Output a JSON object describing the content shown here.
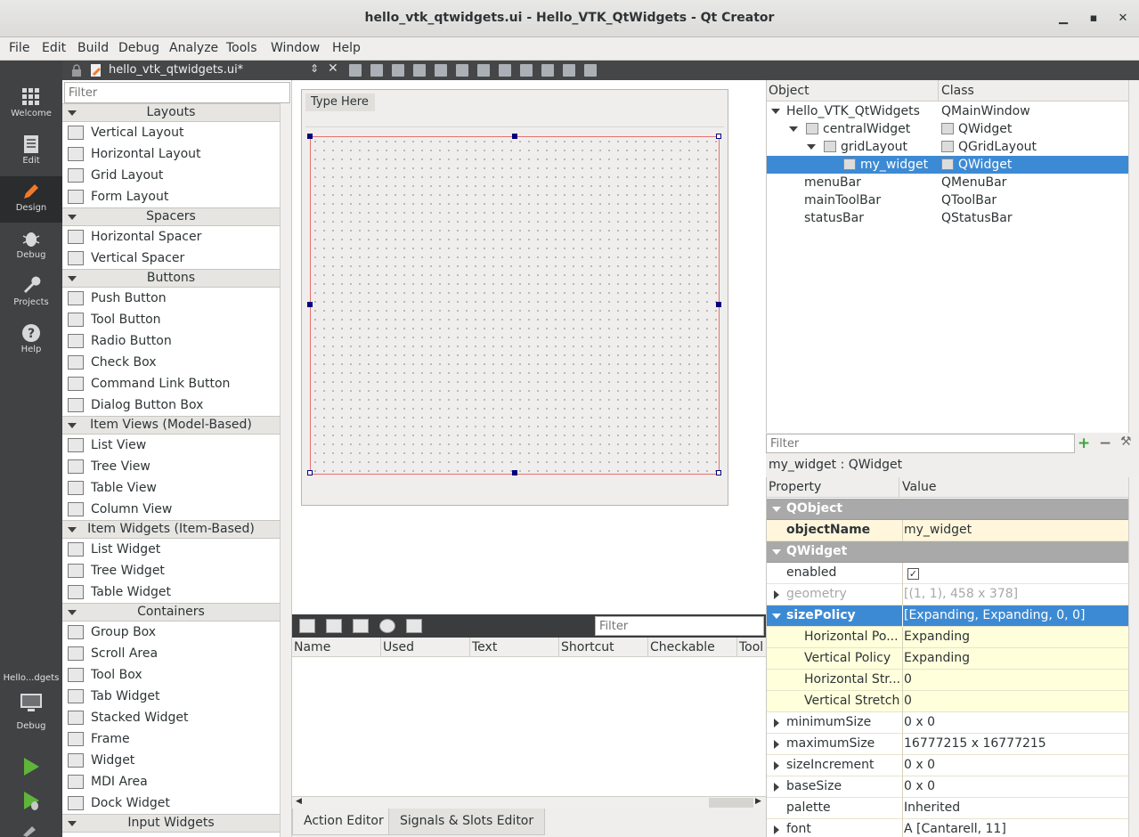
{
  "window": {
    "title": "hello_vtk_qtwidgets.ui - Hello_VTK_QtWidgets - Qt Creator",
    "minimize": "▁",
    "maximize": "▪",
    "close": "✕"
  },
  "menubar": [
    "File",
    "Edit",
    "Build",
    "Debug",
    "Analyze",
    "Tools",
    "Window",
    "Help"
  ],
  "modes": [
    {
      "label": "Welcome",
      "icon": "grid-icon"
    },
    {
      "label": "Edit",
      "icon": "document-icon"
    },
    {
      "label": "Design",
      "icon": "pencil-icon"
    },
    {
      "label": "Debug",
      "icon": "bug-icon"
    },
    {
      "label": "Projects",
      "icon": "wrench-icon"
    },
    {
      "label": "Help",
      "icon": "question-icon"
    }
  ],
  "target": {
    "project": "Hello...dgets",
    "kit": "Debug"
  },
  "editor": {
    "file_name": "hello_vtk_qtwidgets.ui*"
  },
  "widget_box": {
    "filter_placeholder": "Filter",
    "categories": [
      {
        "name": "Layouts",
        "items": [
          "Vertical Layout",
          "Horizontal Layout",
          "Grid Layout",
          "Form Layout"
        ]
      },
      {
        "name": "Spacers",
        "items": [
          "Horizontal Spacer",
          "Vertical Spacer"
        ]
      },
      {
        "name": "Buttons",
        "items": [
          "Push Button",
          "Tool Button",
          "Radio Button",
          "Check Box",
          "Command Link Button",
          "Dialog Button Box"
        ]
      },
      {
        "name": "Item Views (Model-Based)",
        "items": [
          "List View",
          "Tree View",
          "Table View",
          "Column View"
        ]
      },
      {
        "name": "Item Widgets (Item-Based)",
        "items": [
          "List Widget",
          "Tree Widget",
          "Table Widget"
        ]
      },
      {
        "name": "Containers",
        "items": [
          "Group Box",
          "Scroll Area",
          "Tool Box",
          "Tab Widget",
          "Stacked Widget",
          "Frame",
          "Widget",
          "MDI Area",
          "Dock Widget"
        ]
      },
      {
        "name": "Input Widgets",
        "items": []
      }
    ]
  },
  "form": {
    "menu_placeholder": "Type Here"
  },
  "action_editor": {
    "filter_placeholder": "Filter",
    "columns": [
      "Name",
      "Used",
      "Text",
      "Shortcut",
      "Checkable",
      "Tool"
    ],
    "tabs": [
      "Action Editor",
      "Signals & Slots Editor"
    ]
  },
  "object_inspector": {
    "headers": [
      "Object",
      "Class"
    ],
    "rows": [
      {
        "object": "Hello_VTK_QtWidgets",
        "class": "QMainWindow"
      },
      {
        "object": "centralWidget",
        "class": "QWidget"
      },
      {
        "object": "gridLayout",
        "class": "QGridLayout"
      },
      {
        "object": "my_widget",
        "class": "QWidget"
      },
      {
        "object": "menuBar",
        "class": "QMenuBar"
      },
      {
        "object": "mainToolBar",
        "class": "QToolBar"
      },
      {
        "object": "statusBar",
        "class": "QStatusBar"
      }
    ]
  },
  "property_editor": {
    "filter_placeholder": "Filter",
    "selected_label": "my_widget : QWidget",
    "headers": [
      "Property",
      "Value"
    ],
    "rows": [
      {
        "name": "QObject",
        "value": ""
      },
      {
        "name": "objectName",
        "value": "my_widget"
      },
      {
        "name": "QWidget",
        "value": ""
      },
      {
        "name": "enabled",
        "value": "✓"
      },
      {
        "name": "geometry",
        "value": "[(1, 1), 458 x 378]"
      },
      {
        "name": "sizePolicy",
        "value": "[Expanding, Expanding, 0, 0]"
      },
      {
        "name": "Horizontal Po...",
        "value": "Expanding"
      },
      {
        "name": "Vertical Policy",
        "value": "Expanding"
      },
      {
        "name": "Horizontal Str...",
        "value": "0"
      },
      {
        "name": "Vertical Stretch",
        "value": "0"
      },
      {
        "name": "minimumSize",
        "value": "0 x 0"
      },
      {
        "name": "maximumSize",
        "value": "16777215 x 16777215"
      },
      {
        "name": "sizeIncrement",
        "value": "0 x 0"
      },
      {
        "name": "baseSize",
        "value": "0 x 0"
      },
      {
        "name": "palette",
        "value": "Inherited"
      },
      {
        "name": "font",
        "value": "A  [Cantarell, 11]"
      }
    ]
  }
}
